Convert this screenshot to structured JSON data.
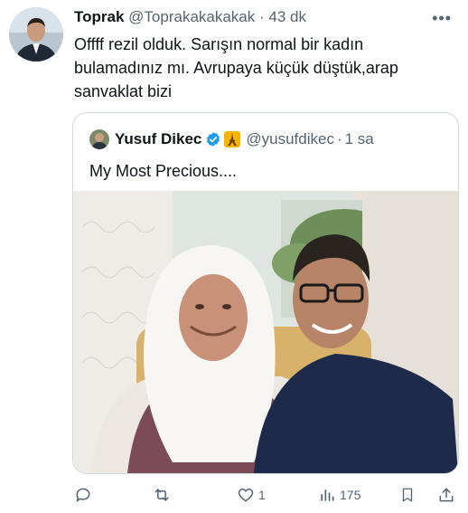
{
  "tweet": {
    "author_name": "Toprak",
    "handle": "@Toprakakakakak",
    "separator": "·",
    "time": "43 dk",
    "more_label": "•••",
    "text": "Offff rezil olduk. Sarışın normal bir kadın bulamadınız mı. Avrupaya küçük düştük,arap sanvaklat bizi"
  },
  "quoted": {
    "author_name": "Yusuf Dikec",
    "handle": "@yusufdikec",
    "separator": "·",
    "time": "1 sa",
    "text": "My Most Precious....",
    "badge_icon": "verified-badge-icon",
    "emoji_icon": "eiffel-tower-icon"
  },
  "actions": {
    "reply": {
      "icon": "reply-icon",
      "count": ""
    },
    "retweet": {
      "icon": "retweet-icon",
      "count": ""
    },
    "like": {
      "icon": "heart-icon",
      "count": "1"
    },
    "views": {
      "icon": "views-icon",
      "count": "175"
    },
    "bookmark": {
      "icon": "bookmark-icon"
    },
    "share": {
      "icon": "share-icon"
    }
  },
  "colors": {
    "text": "#0f1419",
    "muted": "#536471",
    "border": "#cfd9de",
    "verified": "#1d9bf0"
  }
}
